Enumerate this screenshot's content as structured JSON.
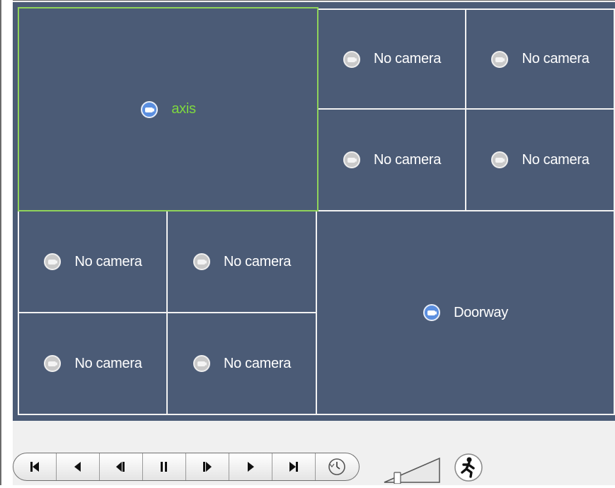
{
  "viewer": {
    "layout_name": "1+1 large with 4x2 small",
    "tiles": [
      {
        "id": "t-axis",
        "label": "axis",
        "status": "assigned",
        "selected": true
      },
      {
        "id": "t1",
        "label": "No camera",
        "status": "empty"
      },
      {
        "id": "t2",
        "label": "No camera",
        "status": "empty"
      },
      {
        "id": "t3",
        "label": "No camera",
        "status": "empty"
      },
      {
        "id": "t4",
        "label": "No camera",
        "status": "empty"
      },
      {
        "id": "t5",
        "label": "No camera",
        "status": "empty"
      },
      {
        "id": "t6",
        "label": "No camera",
        "status": "empty"
      },
      {
        "id": "t7",
        "label": "No camera",
        "status": "empty"
      },
      {
        "id": "t8",
        "label": "No camera",
        "status": "empty"
      },
      {
        "id": "t-doorway",
        "label": "Doorway",
        "status": "assigned"
      }
    ]
  },
  "controls": {
    "buttons": [
      {
        "name": "skip-to-start-button",
        "icon": "skip-start-icon"
      },
      {
        "name": "play-reverse-button",
        "icon": "play-reverse-icon"
      },
      {
        "name": "step-back-button",
        "icon": "step-back-icon"
      },
      {
        "name": "pause-button",
        "icon": "pause-icon"
      },
      {
        "name": "step-forward-button",
        "icon": "step-forward-icon"
      },
      {
        "name": "play-button",
        "icon": "play-icon"
      },
      {
        "name": "skip-to-end-button",
        "icon": "skip-end-icon"
      },
      {
        "name": "speed-button",
        "icon": "clock-icon"
      }
    ],
    "volume_level": 0.1,
    "extra_button_icon": "running-man-icon"
  },
  "colors": {
    "tile_background": "#4b5b76",
    "tile_border": "#f2f2f2",
    "selected_border": "#8fd35a",
    "selected_label": "#7ed83f",
    "camera_assigned": "#5b8fe0",
    "camera_empty": "#c9c9c9"
  }
}
